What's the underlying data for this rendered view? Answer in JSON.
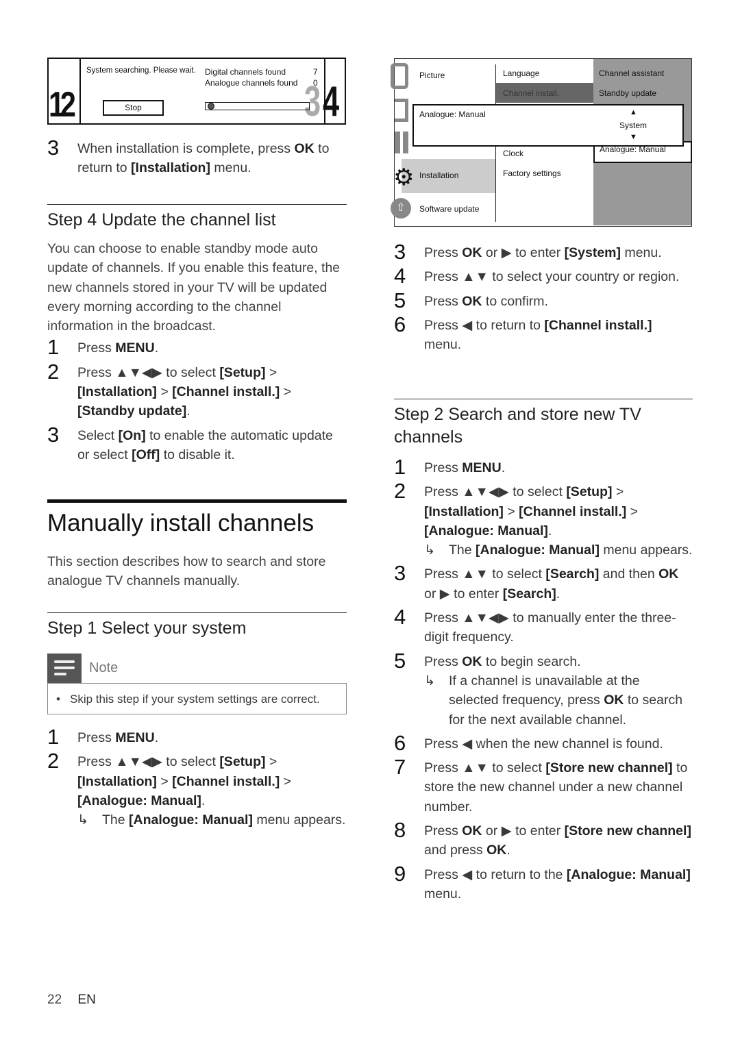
{
  "shot1": {
    "searching": "System searching. Please wait.",
    "digital_label": "Digital channels found",
    "digital_count": "7",
    "analogue_label": "Analogue channels found",
    "analogue_count": "0",
    "stop_label": "Stop",
    "progress": 0.02,
    "left_digits": "12",
    "right_digits_grey": "3",
    "right_digits": "4"
  },
  "shot2": {
    "col1": [
      "Picture",
      "Installation",
      "Software update"
    ],
    "col2": [
      "Language",
      "Channel install.",
      "Clock",
      "Factory settings"
    ],
    "col3": [
      "Channel assistant",
      "Standby update",
      "Analogue: Manual"
    ],
    "popup_title": "Analogue: Manual",
    "popup_value": "System",
    "up": "▲",
    "down": "▼"
  },
  "left_top_steps": [
    {
      "n": "3",
      "s": [
        {
          "t": "When installation is complete, press "
        },
        {
          "t": "OK",
          "b": true
        },
        {
          "t": " to return to "
        },
        {
          "t": "[Installation]",
          "b": true
        },
        {
          "t": " menu."
        }
      ]
    }
  ],
  "step4": {
    "heading": "Step 4 Update the channel list",
    "para": "You can choose to enable standby mode auto update of channels. If you enable this feature, the new channels stored in your TV will be updated every morning according to the channel information in the broadcast.",
    "steps": [
      {
        "n": "1",
        "s": [
          {
            "t": "Press "
          },
          {
            "t": "MENU",
            "b": true
          },
          {
            "t": "."
          }
        ]
      },
      {
        "n": "2",
        "s": [
          {
            "t": "Press ▲▼◀▶ to select "
          },
          {
            "t": "[Setup]",
            "b": true
          },
          {
            "t": " > "
          },
          {
            "t": "[Installation]",
            "b": true
          },
          {
            "t": " > "
          },
          {
            "t": "[Channel install.]",
            "b": true
          },
          {
            "t": " > "
          },
          {
            "t": "[Standby update]",
            "b": true
          },
          {
            "t": "."
          }
        ]
      },
      {
        "n": "3",
        "s": [
          {
            "t": "Select "
          },
          {
            "t": "[On]",
            "b": true
          },
          {
            "t": " to enable the automatic update or select "
          },
          {
            "t": "[Off]",
            "b": true
          },
          {
            "t": " to disable it."
          }
        ]
      }
    ]
  },
  "manual": {
    "title": "Manually install channels",
    "para": "This section describes how to search and store analogue TV channels manually."
  },
  "step1": {
    "heading": "Step 1 Select your system",
    "note_title": "Note",
    "note_text": "Skip this step if your system settings are correct.",
    "steps": [
      {
        "n": "1",
        "s": [
          {
            "t": "Press "
          },
          {
            "t": "MENU",
            "b": true
          },
          {
            "t": "."
          }
        ]
      },
      {
        "n": "2",
        "s": [
          {
            "t": "Press ▲▼◀▶ to select "
          },
          {
            "t": "[Setup]",
            "b": true
          },
          {
            "t": " > "
          },
          {
            "t": "[Installation]",
            "b": true
          },
          {
            "t": " > "
          },
          {
            "t": "[Channel install.]",
            "b": true
          },
          {
            "t": " > "
          },
          {
            "t": "[Analogue: Manual]",
            "b": true
          },
          {
            "t": "."
          }
        ],
        "r": [
          {
            "t": "The "
          },
          {
            "t": "[Analogue: Manual]",
            "b": true
          },
          {
            "t": " menu appears."
          }
        ]
      }
    ]
  },
  "right_top_steps": [
    {
      "n": "3",
      "s": [
        {
          "t": "Press "
        },
        {
          "t": "OK",
          "b": true
        },
        {
          "t": " or ▶ to enter "
        },
        {
          "t": "[System]",
          "b": true
        },
        {
          "t": " menu."
        }
      ]
    },
    {
      "n": "4",
      "s": [
        {
          "t": "Press ▲▼ to select your country or region."
        }
      ]
    },
    {
      "n": "5",
      "s": [
        {
          "t": "Press "
        },
        {
          "t": "OK",
          "b": true
        },
        {
          "t": " to confirm."
        }
      ]
    },
    {
      "n": "6",
      "s": [
        {
          "t": "Press ◀ to return to "
        },
        {
          "t": "[Channel install.]",
          "b": true
        },
        {
          "t": " menu."
        }
      ]
    }
  ],
  "step2": {
    "heading": "Step 2 Search and store new TV channels",
    "steps": [
      {
        "n": "1",
        "s": [
          {
            "t": "Press "
          },
          {
            "t": "MENU",
            "b": true
          },
          {
            "t": "."
          }
        ]
      },
      {
        "n": "2",
        "s": [
          {
            "t": "Press ▲▼◀▶ to select "
          },
          {
            "t": "[Setup]",
            "b": true
          },
          {
            "t": " > "
          },
          {
            "t": "[Installation]",
            "b": true
          },
          {
            "t": " > "
          },
          {
            "t": "[Channel install.]",
            "b": true
          },
          {
            "t": " > "
          },
          {
            "t": "[Analogue: Manual]",
            "b": true
          },
          {
            "t": "."
          }
        ],
        "r": [
          {
            "t": "The "
          },
          {
            "t": "[Analogue: Manual]",
            "b": true
          },
          {
            "t": " menu appears."
          }
        ]
      },
      {
        "n": "3",
        "s": [
          {
            "t": "Press ▲▼ to select "
          },
          {
            "t": "[Search]",
            "b": true
          },
          {
            "t": " and then "
          },
          {
            "t": "OK",
            "b": true
          },
          {
            "t": " or ▶ to enter "
          },
          {
            "t": "[Search]",
            "b": true
          },
          {
            "t": "."
          }
        ]
      },
      {
        "n": "4",
        "s": [
          {
            "t": "Press ▲▼◀▶ to manually enter the three-digit frequency."
          }
        ]
      },
      {
        "n": "5",
        "s": [
          {
            "t": "Press "
          },
          {
            "t": "OK",
            "b": true
          },
          {
            "t": " to begin search."
          }
        ],
        "r": [
          {
            "t": "If a channel is unavailable at the selected frequency, press "
          },
          {
            "t": "OK",
            "b": true
          },
          {
            "t": " to search for the next available channel."
          }
        ]
      },
      {
        "n": "6",
        "s": [
          {
            "t": "Press ◀  when the new channel is found."
          }
        ]
      },
      {
        "n": "7",
        "s": [
          {
            "t": "Press ▲▼ to select "
          },
          {
            "t": "[Store new channel]",
            "b": true
          },
          {
            "t": " to store the new channel under a new channel number."
          }
        ]
      },
      {
        "n": "8",
        "s": [
          {
            "t": "Press "
          },
          {
            "t": "OK",
            "b": true
          },
          {
            "t": " or ▶ to enter "
          },
          {
            "t": "[Store new channel]",
            "b": true
          },
          {
            "t": " and press "
          },
          {
            "t": "OK",
            "b": true
          },
          {
            "t": "."
          }
        ]
      },
      {
        "n": "9",
        "s": [
          {
            "t": "Press ◀ to return to the "
          },
          {
            "t": "[Analogue: Manual]",
            "b": true
          },
          {
            "t": " menu."
          }
        ]
      }
    ]
  },
  "footer": {
    "page": "22",
    "lang": "EN"
  },
  "result_arrow": "↳"
}
